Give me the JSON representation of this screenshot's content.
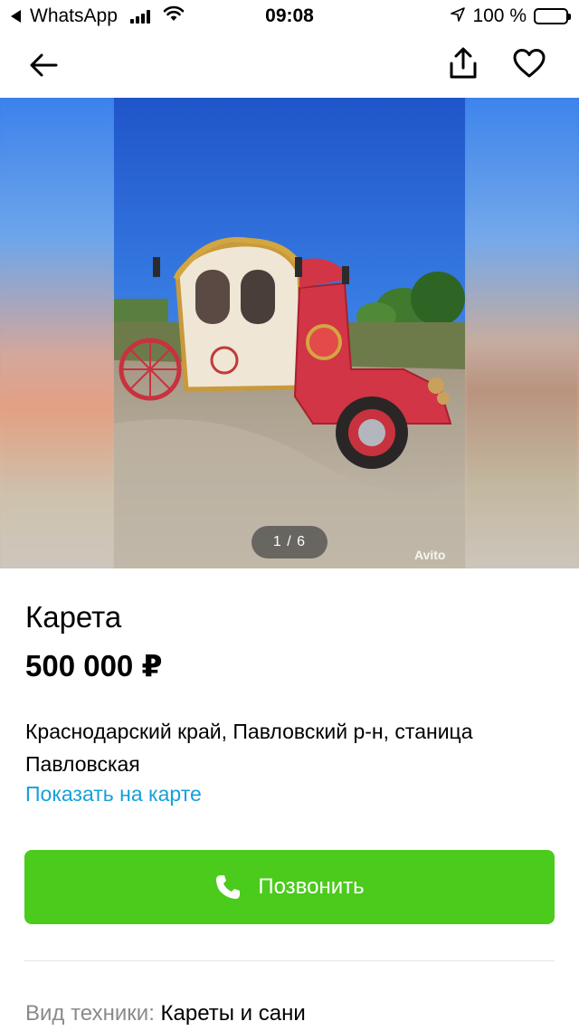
{
  "status_bar": {
    "back_app": "WhatsApp",
    "time": "09:08",
    "battery": "100 %",
    "icons": [
      "signal-icon",
      "wifi-icon",
      "location-arrow-icon",
      "battery-icon"
    ]
  },
  "nav": {
    "icons": [
      "back-arrow-icon",
      "share-icon",
      "heart-icon"
    ]
  },
  "gallery": {
    "counter": "1 / 6",
    "current": 1,
    "total": 6,
    "watermark": "Avito"
  },
  "listing": {
    "title": "Карета",
    "price": "500 000 ₽",
    "address": "Краснодарский край, Павловский р-н, станица Павловская",
    "map_link": "Показать на карте",
    "call_button": "Позвонить",
    "param_label": "Вид техники:",
    "param_value": "Кареты и сани"
  },
  "colors": {
    "accent_green": "#4bcb1b",
    "link_blue": "#14a0dc",
    "muted_gray": "#8a8a8a"
  }
}
